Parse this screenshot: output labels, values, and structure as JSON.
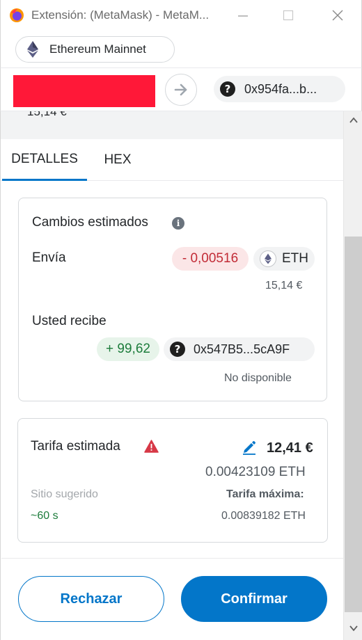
{
  "window": {
    "title": "Extensión: (MetaMask) - MetaM...",
    "minimize_symbol": "—",
    "maximize_symbol": "☐",
    "close_symbol": "✕"
  },
  "network": {
    "label": "Ethereum Mainnet",
    "icon": "ethereum-icon"
  },
  "account": {
    "arrow_icon": "arrow-right-icon",
    "recipient_address": "0x954fa...b...",
    "recipient_icon_glyph": "?"
  },
  "partial_value": "15,14 €",
  "tabs": [
    {
      "label": "DETALLES",
      "active": true
    },
    {
      "label": "HEX",
      "active": false
    }
  ],
  "estimated_changes": {
    "title": "Cambios estimados",
    "info_glyph": "i",
    "send": {
      "label": "Envía",
      "amount": "- 0,00516",
      "token": "ETH",
      "fiat": "15,14 €"
    },
    "receive": {
      "label": "Usted recibe",
      "amount": "+ 99,62",
      "token_glyph": "?",
      "token_address": "0x547B5...5cA9F",
      "fiat": "No disponible"
    }
  },
  "fee": {
    "title": "Tarifa estimada",
    "warning_icon": "warning-icon",
    "edit_icon": "pencil-icon",
    "fiat": "12,41 €",
    "eth": "0.00423109 ETH",
    "site_suggested": "Sitio sugerido",
    "time": "~60 s",
    "max_label": "Tarifa máxima:",
    "max_value": "0.00839182 ETH"
  },
  "footer": {
    "reject_label": "Rechazar",
    "confirm_label": "Confirmar"
  },
  "colors": {
    "accent": "#0376c9",
    "redacted": "#ff1838",
    "negative": "#c22b36",
    "positive": "#1c7c3b",
    "warning": "#d73847"
  }
}
